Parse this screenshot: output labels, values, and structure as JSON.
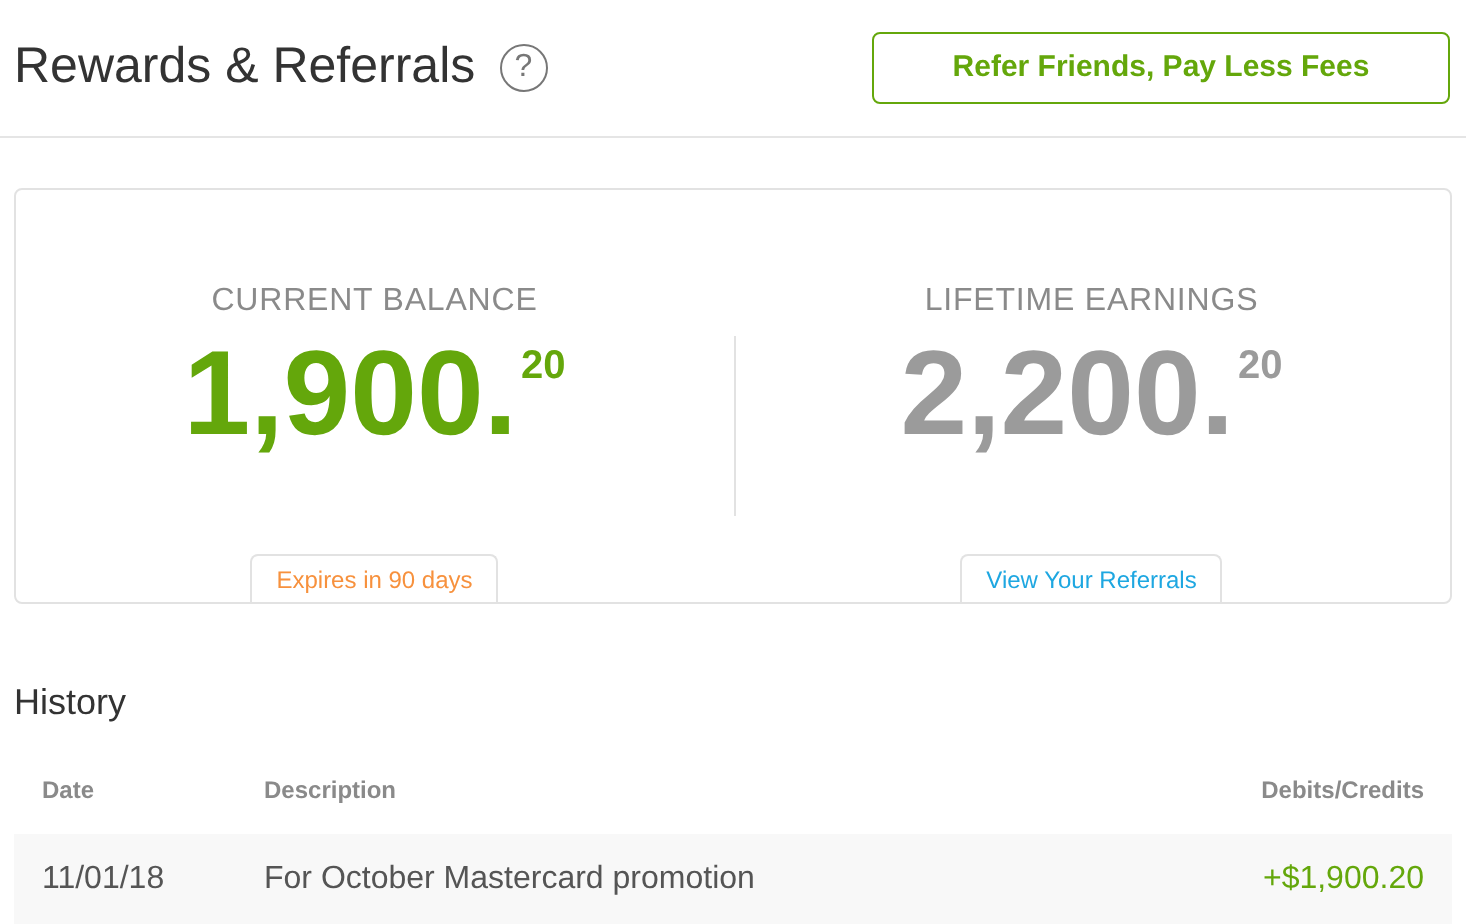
{
  "header": {
    "title": "Rewards & Referrals",
    "help_icon": "?",
    "action_button": "Refer Friends, Pay Less Fees"
  },
  "stats": [
    {
      "label": "CURRENT BALANCE",
      "whole": "1,900.",
      "cents": "20",
      "color": "#64a70b",
      "tag": {
        "text": "Expires in 90 days",
        "color": "#f7913d"
      }
    },
    {
      "label": "LIFETIME EARNINGS",
      "whole": "2,200.",
      "cents": "20",
      "color": "#9b9b9b",
      "tag": {
        "text": "View Your Referrals",
        "color": "#1ea7e1"
      }
    }
  ],
  "history": {
    "title": "History",
    "columns": [
      "Date",
      "Description",
      "Debits/Credits"
    ],
    "rows": [
      {
        "date": "11/01/18",
        "description": "For October Mastercard promotion",
        "amount": "+$1,900.20"
      }
    ]
  }
}
